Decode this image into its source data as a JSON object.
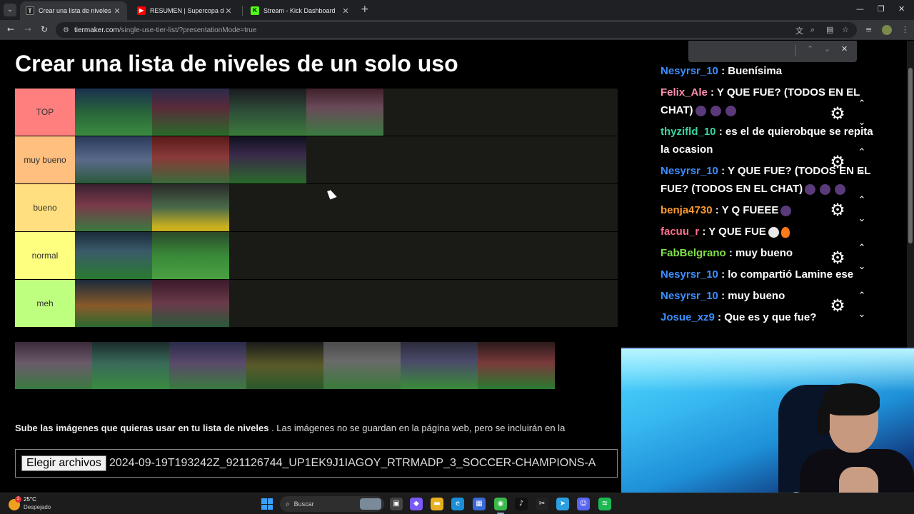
{
  "browser": {
    "tabs": [
      {
        "title": "Crear una lista de niveles de un",
        "favicon_color": "#222222",
        "favicon_glyph": "T",
        "active": true
      },
      {
        "title": "RESUMEN | Supercopa de Espa",
        "favicon_color": "#ff0000",
        "favicon_glyph": "▶",
        "active": false
      },
      {
        "title": "Stream - Kick Dashboard",
        "favicon_color": "#53fc18",
        "favicon_glyph": "K",
        "active": false
      }
    ],
    "url_host": "tiermaker.com",
    "url_path": "/single-use-tier-list/?presentationMode=true",
    "icons": {
      "tab_menu": "chevron-down-icon",
      "new_tab": "plus-icon",
      "minimize": "minimize-icon",
      "restore": "restore-icon",
      "close": "close-icon"
    }
  },
  "page": {
    "title": "Crear una lista de niveles de un solo uso",
    "tiers": [
      {
        "label": "TOP",
        "color": "#ff7f7f",
        "items": 4
      },
      {
        "label": "muy bueno",
        "color": "#ffbf7f",
        "items": 3
      },
      {
        "label": "bueno",
        "color": "#ffdf7f",
        "items": 2
      },
      {
        "label": "normal",
        "color": "#ffff7f",
        "items": 2
      },
      {
        "label": "meh",
        "color": "#bfff7f",
        "items": 2
      }
    ],
    "pool_items": 7,
    "description_bold": "Sube las imágenes que quieras usar en tu lista de niveles",
    "description_rest": " . Las imágenes no se guardan en la página web, pero se incluirán en la",
    "file_button": "Elegir archivos",
    "file_name": "2024-09-19T193242Z_921126744_UP1EK9J1IAGOY_RTRMADP_3_SOCCER-CHAMPIONS-A"
  },
  "chat": {
    "messages": [
      {
        "user": "Nesyrsr_10",
        "color": "#3a8fff",
        "text": " : Buenísima"
      },
      {
        "user": "Felix_Ale",
        "color": "#ff8fb0",
        "text": " : Y QUE FUE? (TODOS EN EL CHAT)",
        "emojis": 3
      },
      {
        "user": "thyzifld_10",
        "color": "#3bd6a0",
        "text": " : es el de quierobque se repita la ocasion"
      },
      {
        "user": "Nesyrsr_10",
        "color": "#3a8fff",
        "text": " : Y QUE FUE? (TODOS EN EL FUE? (TODOS EN EL CHAT)",
        "emojis": 3
      },
      {
        "user": "benja4730",
        "color": "#ff9a2e",
        "text": " : Y Q FUEEE",
        "emojis": 1
      },
      {
        "user": "facuu_r",
        "color": "#ff6f8a",
        "text": " : Y QUE FUE",
        "fire": true
      },
      {
        "user": "FabBelgrano",
        "color": "#7fe04a",
        "text": " : muy bueno"
      },
      {
        "user": "Nesyrsr_10",
        "color": "#3a8fff",
        "text": " : lo compartió Lamine ese"
      },
      {
        "user": "Nesyrsr_10",
        "color": "#3a8fff",
        "text": " : muy bueno"
      },
      {
        "user": "Josue_xz9",
        "color": "#3a8fff",
        "text": " : Que es y que fue?"
      }
    ],
    "control_icons": [
      "gear-icon",
      "chevron-up-icon",
      "chevron-down-icon"
    ]
  },
  "taskbar": {
    "temperature": "25°C",
    "condition": "Despejado",
    "badge": "2",
    "search_placeholder": "Buscar",
    "apps": [
      {
        "name": "task-view-icon",
        "color": "#444444",
        "glyph": "▣"
      },
      {
        "name": "copilot-icon",
        "color": "#7a5af8",
        "glyph": "◆"
      },
      {
        "name": "file-explorer-icon",
        "color": "#e8b020",
        "glyph": "▬"
      },
      {
        "name": "edge-icon",
        "color": "#1a8fd8",
        "glyph": "e"
      },
      {
        "name": "store-icon",
        "color": "#3a6ad8",
        "glyph": "▦"
      },
      {
        "name": "chrome-icon",
        "color": "#3ab84a",
        "glyph": "◉"
      },
      {
        "name": "tiktok-icon",
        "color": "#111111",
        "glyph": "♪"
      },
      {
        "name": "capcut-icon",
        "color": "#222222",
        "glyph": "✂"
      },
      {
        "name": "telegram-icon",
        "color": "#2aa0e0",
        "glyph": "➤"
      },
      {
        "name": "discord-icon",
        "color": "#5865f2",
        "glyph": "☺"
      },
      {
        "name": "spotify-icon",
        "color": "#1db954",
        "glyph": "≋"
      }
    ]
  }
}
